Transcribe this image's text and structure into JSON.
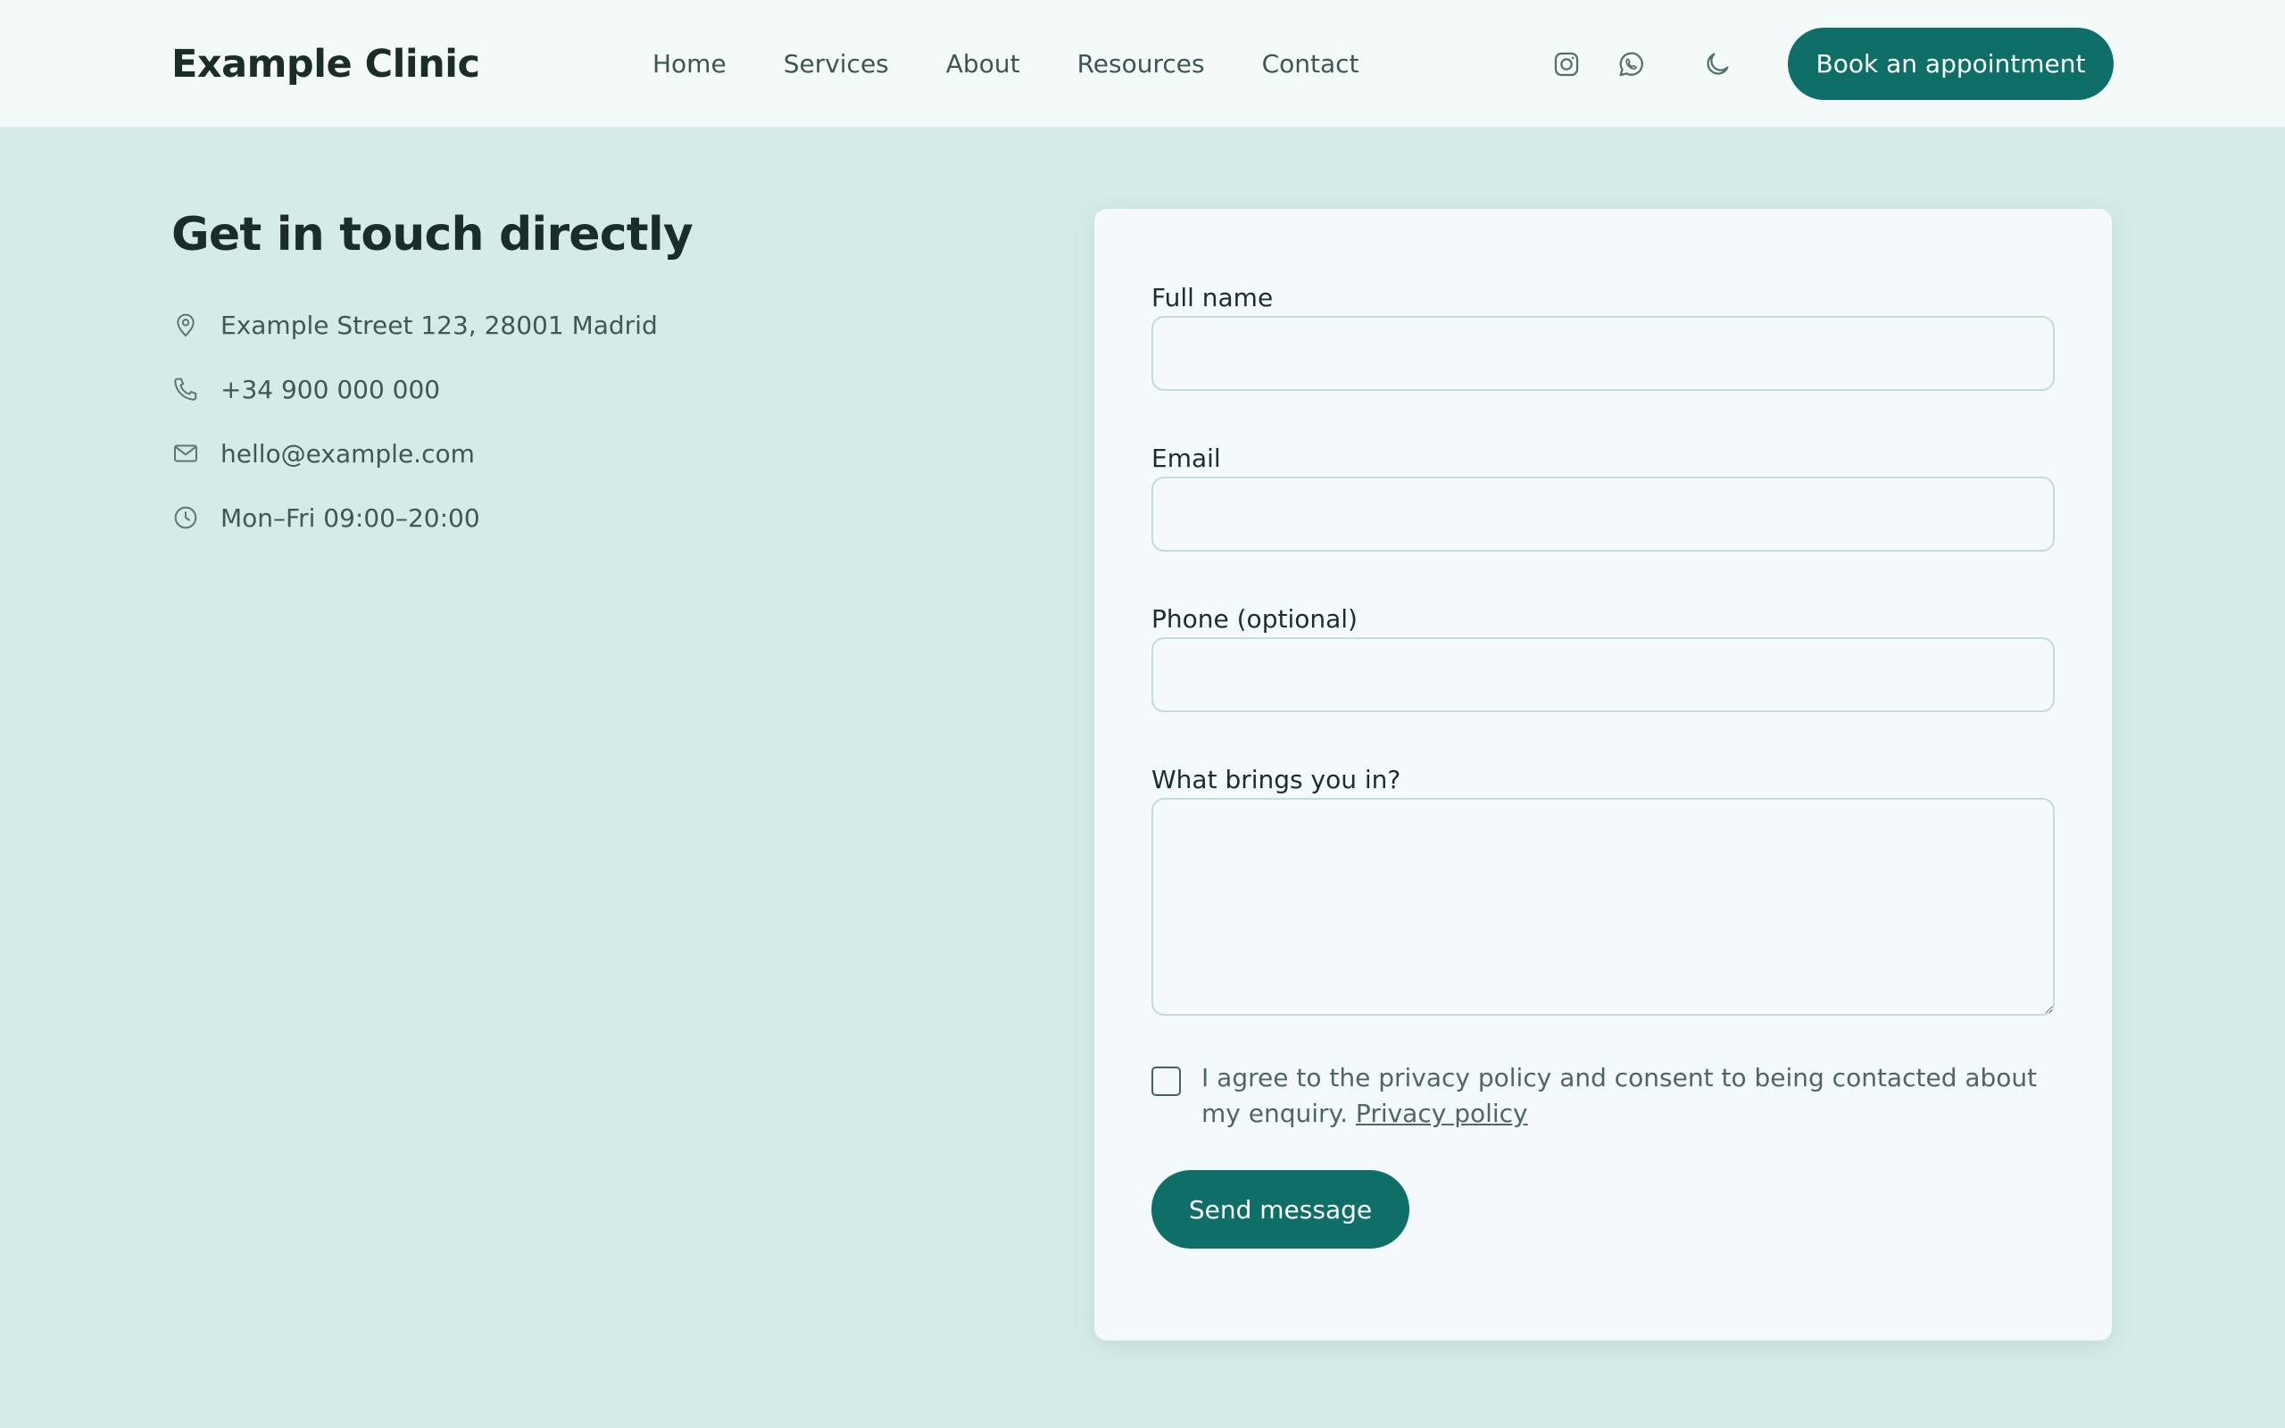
{
  "header": {
    "brand": "Example Clinic",
    "nav": [
      "Home",
      "Services",
      "About",
      "Resources",
      "Contact"
    ],
    "icons": [
      "instagram-icon",
      "whatsapp-icon",
      "moon-icon"
    ],
    "cta_label": "Book an appointment"
  },
  "contact": {
    "title": "Get in touch directly",
    "items": [
      {
        "icon": "location-pin-icon",
        "text": "Example Street 123, 28001 Madrid"
      },
      {
        "icon": "phone-icon",
        "text": "+34 900 000 000"
      },
      {
        "icon": "mail-icon",
        "text": "hello@example.com"
      },
      {
        "icon": "clock-icon",
        "text": "Mon–Fri 09:00–20:00"
      }
    ]
  },
  "form": {
    "fields": [
      {
        "label": "Full name",
        "value": ""
      },
      {
        "label": "Email",
        "value": ""
      },
      {
        "label": "Phone (optional)",
        "value": ""
      },
      {
        "label": "What brings you in?",
        "value": ""
      }
    ],
    "consent_text": "I agree to the privacy policy and consent to being contacted about my enquiry.",
    "consent_link": "Privacy policy",
    "consent_checked": false,
    "submit_label": "Send message"
  },
  "colors": {
    "accent": "#0e6f69",
    "page_bg": "#d5ebe7",
    "header_bg": "#f4f9fa",
    "card_bg": "#f4f9fb"
  }
}
